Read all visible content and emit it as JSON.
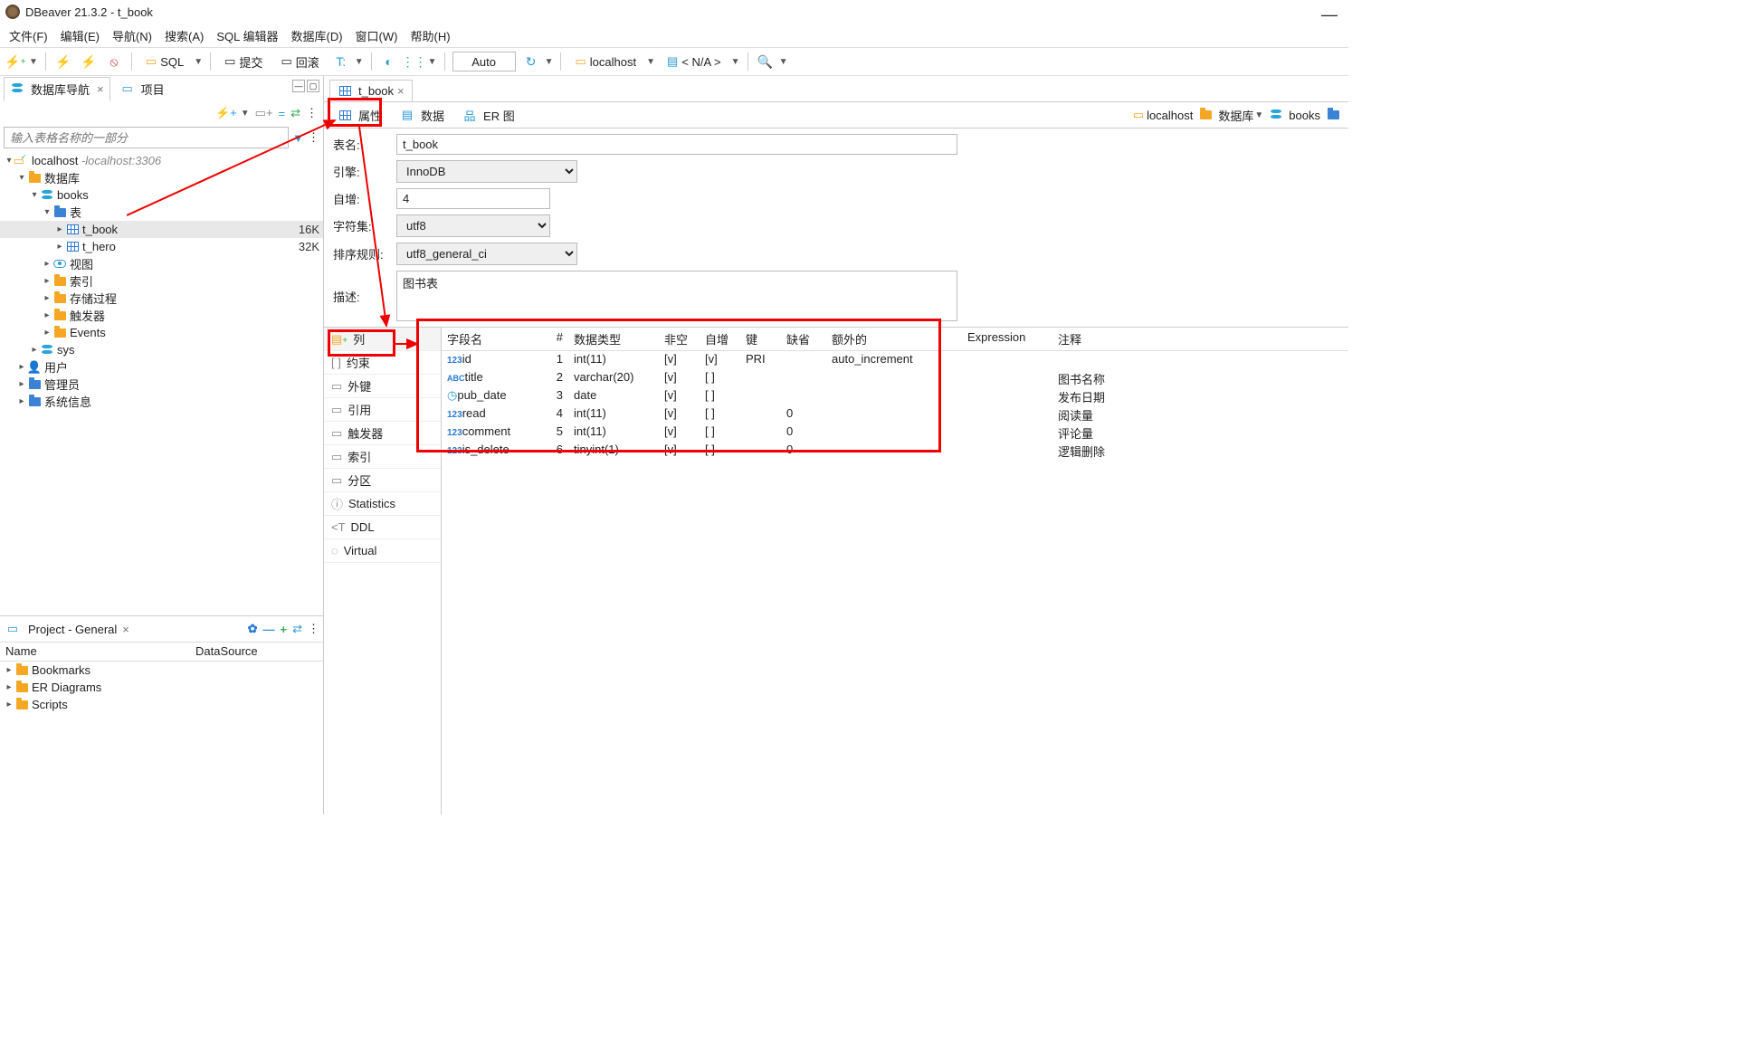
{
  "title": "DBeaver 21.3.2 - t_book",
  "menu": [
    "文件(F)",
    "编辑(E)",
    "导航(N)",
    "搜索(A)",
    "SQL 编辑器",
    "数据库(D)",
    "窗口(W)",
    "帮助(H)"
  ],
  "toolbar": {
    "sql": "SQL",
    "commit": "提交",
    "rollback": "回滚",
    "auto": "Auto",
    "conn": "localhost",
    "db": "< N/A >"
  },
  "left_tabs": {
    "nav": "数据库导航",
    "proj": "项目"
  },
  "search_ph": "输入表格名称的一部分",
  "tree": {
    "host": "localhost",
    "hostsub": "localhost:3306",
    "db": "数据库",
    "schema": "books",
    "tables": "表",
    "t_book": "t_book",
    "t_book_sz": "16K",
    "t_hero": "t_hero",
    "t_hero_sz": "32K",
    "views": "视图",
    "idx": "索引",
    "procs": "存储过程",
    "trig": "触发器",
    "events": "Events",
    "sys": "sys",
    "users": "用户",
    "admin": "管理员",
    "sysinfo": "系统信息"
  },
  "project": {
    "title": "Project - General",
    "col1": "Name",
    "col2": "DataSource",
    "items": [
      "Bookmarks",
      "ER Diagrams",
      "Scripts"
    ]
  },
  "editor": {
    "tab": "t_book",
    "sub_props": "属性",
    "sub_data": "数据",
    "sub_er": "ER 图"
  },
  "bc": {
    "host": "localhost",
    "db": "数据库",
    "schema": "books"
  },
  "form": {
    "name_l": "表名:",
    "name_v": "t_book",
    "eng_l": "引擎:",
    "eng_v": "InnoDB",
    "ai_l": "自增:",
    "ai_v": "4",
    "cs_l": "字符集:",
    "cs_v": "utf8",
    "coll_l": "排序规则:",
    "coll_v": "utf8_general_ci",
    "desc_l": "描述:",
    "desc_v": "图书表"
  },
  "cats": {
    "cols": "列",
    "cons": "约束",
    "fk": "外键",
    "ref": "引用",
    "trig": "触发器",
    "idx": "索引",
    "part": "分区",
    "stat": "Statistics",
    "ddl": "DDL",
    "virt": "Virtual"
  },
  "colhdr": {
    "name": "字段名",
    "num": "#",
    "type": "数据类型",
    "nn": "非空",
    "ai": "自增",
    "key": "键",
    "def": "缺省",
    "extra": "额外的",
    "expr": "Expression",
    "cmt": "注释"
  },
  "chart_data": {
    "type": "table",
    "columns": [
      "字段名",
      "#",
      "数据类型",
      "非空",
      "自增",
      "键",
      "缺省",
      "额外的",
      "Expression",
      "注释"
    ],
    "rows": [
      {
        "name": "id",
        "num": 1,
        "type": "int(11)",
        "nn": "[v]",
        "ai": "[v]",
        "key": "PRI",
        "def": "",
        "extra": "auto_increment",
        "expr": "",
        "cmt": "",
        "icon": "num"
      },
      {
        "name": "title",
        "num": 2,
        "type": "varchar(20)",
        "nn": "[v]",
        "ai": "[ ]",
        "key": "",
        "def": "",
        "extra": "",
        "expr": "",
        "cmt": "图书名称",
        "icon": "abc"
      },
      {
        "name": "pub_date",
        "num": 3,
        "type": "date",
        "nn": "[v]",
        "ai": "[ ]",
        "key": "",
        "def": "",
        "extra": "",
        "expr": "",
        "cmt": "发布日期",
        "icon": "clk"
      },
      {
        "name": "read",
        "num": 4,
        "type": "int(11)",
        "nn": "[v]",
        "ai": "[ ]",
        "key": "",
        "def": "0",
        "extra": "",
        "expr": "",
        "cmt": "阅读量",
        "icon": "num"
      },
      {
        "name": "comment",
        "num": 5,
        "type": "int(11)",
        "nn": "[v]",
        "ai": "[ ]",
        "key": "",
        "def": "0",
        "extra": "",
        "expr": "",
        "cmt": "评论量",
        "icon": "num"
      },
      {
        "name": "is_delete",
        "num": 6,
        "type": "tinyint(1)",
        "nn": "[v]",
        "ai": "[ ]",
        "key": "",
        "def": "0",
        "extra": "",
        "expr": "",
        "cmt": "逻辑删除",
        "icon": "num"
      }
    ]
  }
}
